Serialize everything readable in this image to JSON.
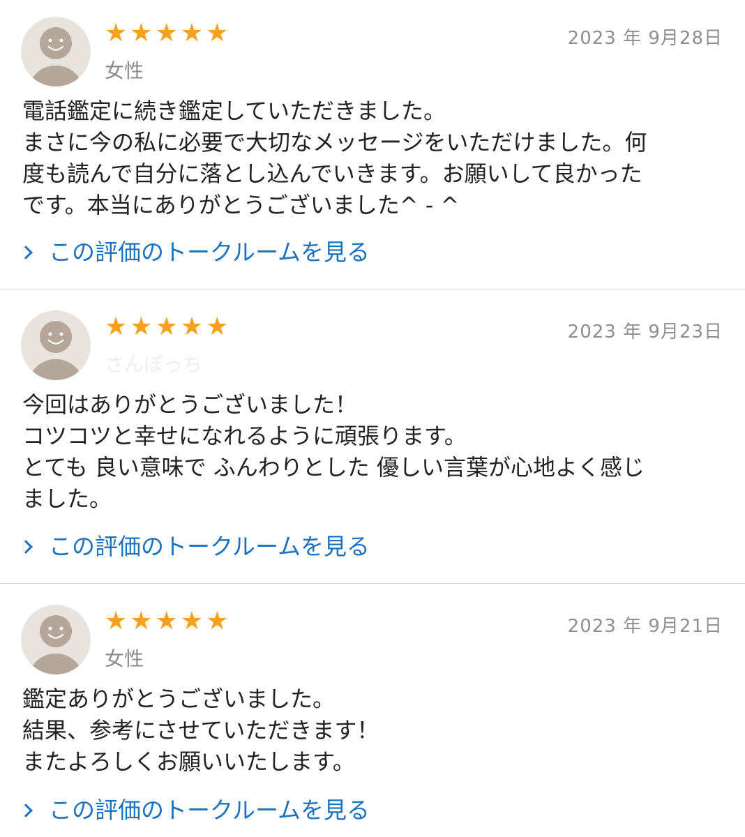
{
  "reviews": [
    {
      "rating": 5,
      "stars": [
        "★",
        "★",
        "★",
        "★",
        "★"
      ],
      "date": "2023 年 9月28日",
      "user": "女性",
      "lines": [
        "電話鑑定に続き鑑定していただきました。",
        "まさに今の私に必要で大切なメッセージをいただけました。何",
        "度も読んで自分に落とし込んでいきます。お願いして良かった",
        "です。本当にありがとうございました^ - ^"
      ],
      "link_label": "この評価のトークルームを見る"
    },
    {
      "rating": 5,
      "stars": [
        "★",
        "★",
        "★",
        "★",
        "★"
      ],
      "date": "2023 年 9月23日",
      "user": "さんぽっち",
      "lines": [
        "今回はありがとうございました！",
        "コツコツと幸せになれるように頑張ります。",
        "とても 良い意味で ふんわりとした 優しい言葉が心地よく感じ",
        "ました。"
      ],
      "link_label": "この評価のトークルームを見る"
    },
    {
      "rating": 5,
      "stars": [
        "★",
        "★",
        "★",
        "★",
        "★"
      ],
      "date": "2023 年 9月21日",
      "user": "女性",
      "lines": [
        "鑑定ありがとうございました。",
        "結果、参考にさせていただきます！",
        "またよろしくお願いいたします。"
      ],
      "link_label": "この評価のトークルームを見る"
    }
  ],
  "colors": {
    "star": "#f6a01f",
    "link": "#1a72c0",
    "date": "#8e8e8e",
    "avatar_bg": "#e8e3de",
    "avatar_fg": "#b5a69a"
  },
  "icons": {
    "avatar": "default-user-avatar-icon",
    "star": "star-icon",
    "link": "chevron-right-icon"
  }
}
